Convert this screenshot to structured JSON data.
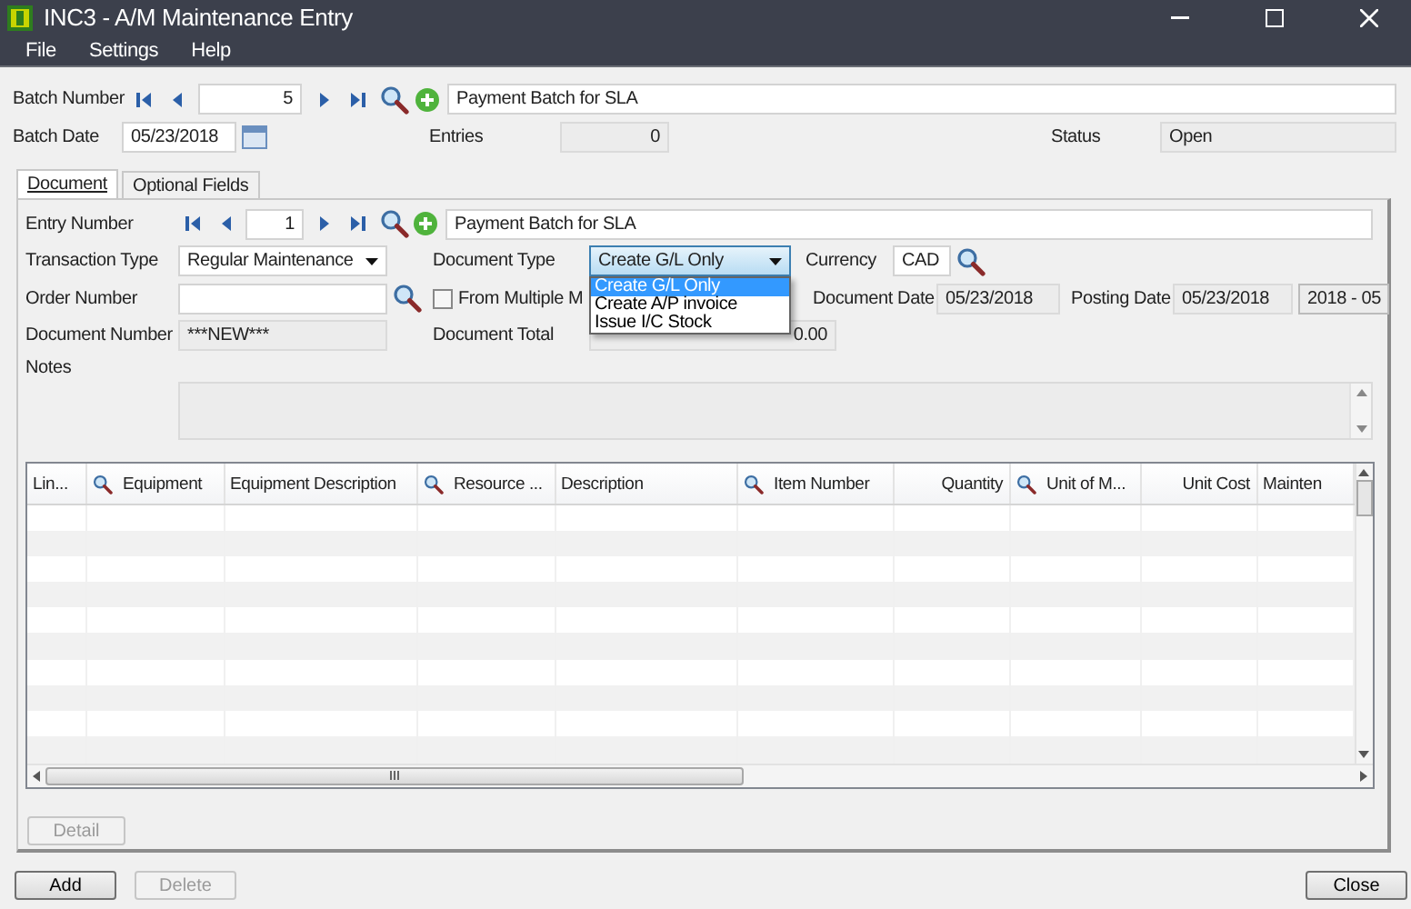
{
  "window": {
    "title": "INC3 - A/M Maintenance Entry"
  },
  "menu": [
    "File",
    "Settings",
    "Help"
  ],
  "batch": {
    "number_label": "Batch Number",
    "number": "5",
    "description": "Payment Batch for SLA",
    "date_label": "Batch Date",
    "date": "05/23/2018",
    "entries_label": "Entries",
    "entries": "0",
    "status_label": "Status",
    "status": "Open"
  },
  "tabs": [
    {
      "label": "Document",
      "selected": true
    },
    {
      "label": "Optional Fields",
      "selected": false
    }
  ],
  "document": {
    "entry_label": "Entry Number",
    "entry_number": "1",
    "entry_description": "Payment Batch for SLA",
    "transaction_type_label": "Transaction Type",
    "transaction_type": "Regular Maintenance",
    "document_type_label": "Document Type",
    "document_type": "Create G/L Only",
    "document_type_options": [
      {
        "label": "Create G/L Only",
        "selected": true
      },
      {
        "label": "Create A/P invoice",
        "selected": false
      },
      {
        "label": "Issue I/C Stock",
        "selected": false
      }
    ],
    "currency_label": "Currency",
    "currency": "CAD",
    "order_number_label": "Order Number",
    "from_multiple": {
      "label": "From Multiple M",
      "checked": false
    },
    "document_date_label": "Document Date",
    "document_date": "05/23/2018",
    "posting_date_label": "Posting Date",
    "posting_date": "05/23/2018",
    "period": "2018 - 05",
    "document_number_label": "Document Number",
    "document_number": "***NEW***",
    "document_total_label": "Document Total",
    "document_total": "0.00",
    "notes_label": "Notes"
  },
  "table": {
    "columns": [
      {
        "label": "Lin...",
        "lookup": false,
        "right_aligned": false
      },
      {
        "label": "Equipment",
        "lookup": true,
        "right_aligned": false
      },
      {
        "label": "Equipment Description",
        "lookup": false,
        "right_aligned": false
      },
      {
        "label": "Resource ...",
        "lookup": true,
        "right_aligned": false
      },
      {
        "label": "Description",
        "lookup": false,
        "right_aligned": false
      },
      {
        "label": "Item Number",
        "lookup": true,
        "right_aligned": false
      },
      {
        "label": "Quantity",
        "lookup": false,
        "right_aligned": true
      },
      {
        "label": "Unit of M...",
        "lookup": true,
        "right_aligned": false
      },
      {
        "label": "Unit Cost",
        "lookup": false,
        "right_aligned": true
      },
      {
        "label": "Mainten",
        "lookup": false,
        "right_aligned": false
      }
    ]
  },
  "detail_button": {
    "label": "Detail",
    "disabled": true
  },
  "buttons": [
    {
      "label": "Add",
      "disabled": false
    },
    {
      "label": "Delete",
      "disabled": true
    }
  ],
  "close_button": {
    "label": "Close",
    "disabled": false
  }
}
